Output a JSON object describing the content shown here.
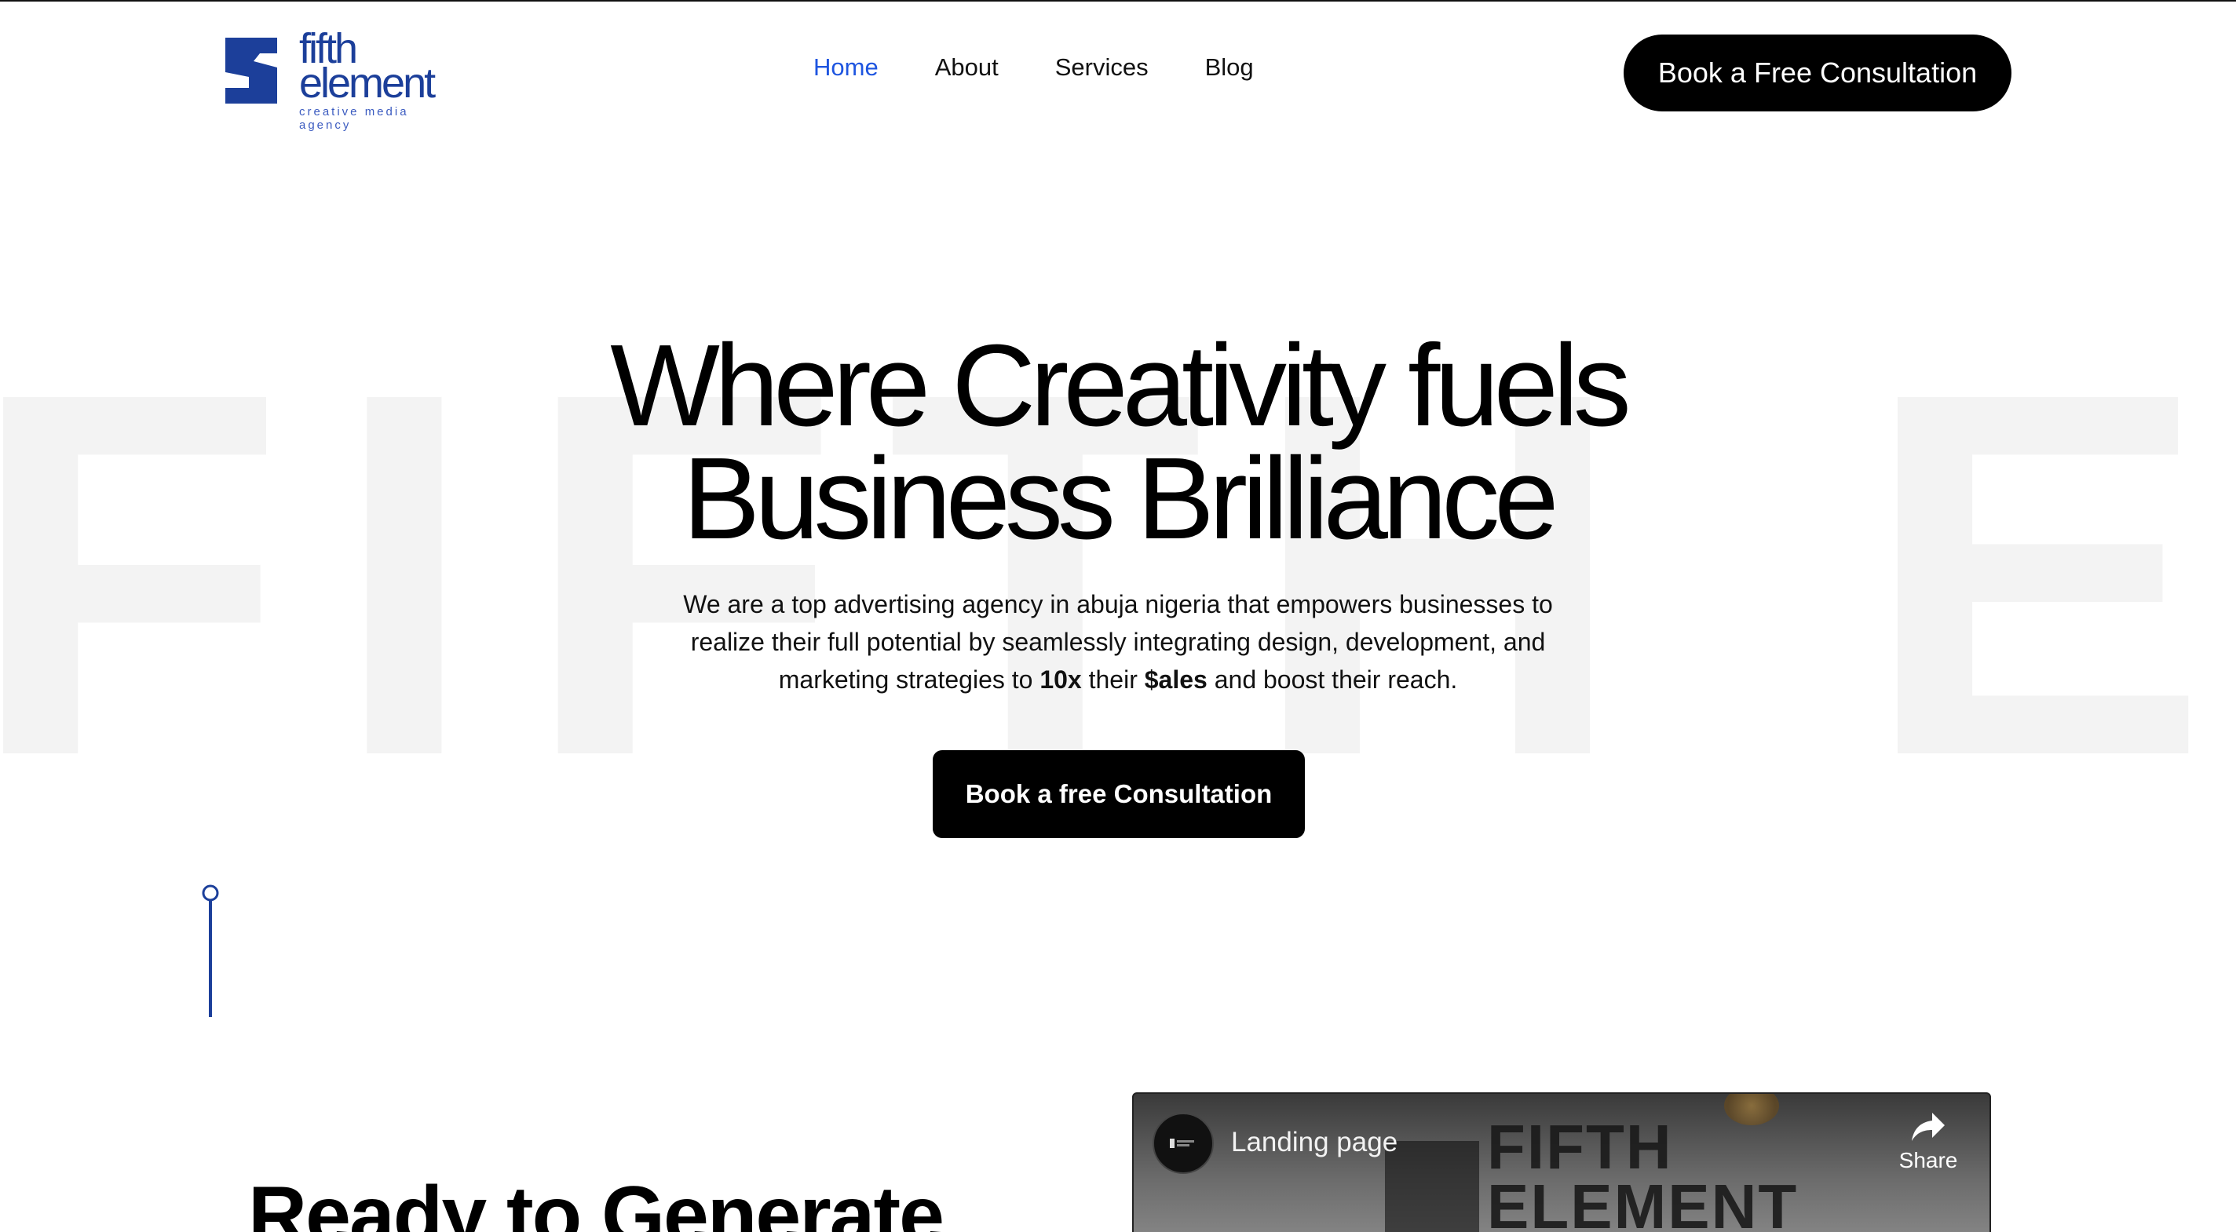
{
  "header": {
    "logo": {
      "word_top": "fifth",
      "word_bottom": "element",
      "tagline": "creative media agency"
    },
    "nav": [
      {
        "label": "Home",
        "active": true
      },
      {
        "label": "About",
        "active": false
      },
      {
        "label": "Services",
        "active": false
      },
      {
        "label": "Blog",
        "active": false
      }
    ],
    "cta_label": "Book a Free Consultation"
  },
  "hero": {
    "watermark": "FIFTH ELEMENT",
    "title_line1": "Where Creativity fuels",
    "title_line2": "Business Brilliance",
    "desc_part1": "We are a top advertising agency in abuja nigeria that empowers businesses to realize their full potential by seamlessly integrating design, development, and marketing strategies to ",
    "desc_bold1": "10x",
    "desc_part2": " their ",
    "desc_bold2": "$ales",
    "desc_part3": " and boost their reach.",
    "cta_label": "Book a free Consultation"
  },
  "section2": {
    "heading": "Ready to Generate",
    "video": {
      "title": "Landing page",
      "share_label": "Share",
      "bg_text_line1": "FIFTH",
      "bg_text_line2": "ELEMENT"
    }
  },
  "colors": {
    "brand_blue": "#1c3f9a",
    "nav_active": "#1e55e0",
    "button_bg": "#000000",
    "watermark": "#f3f3f3"
  },
  "icons": {
    "logo_mark": "fifth-element-logo-mark",
    "scroll": "scroll-indicator-icon",
    "share": "share-arrow-icon"
  }
}
